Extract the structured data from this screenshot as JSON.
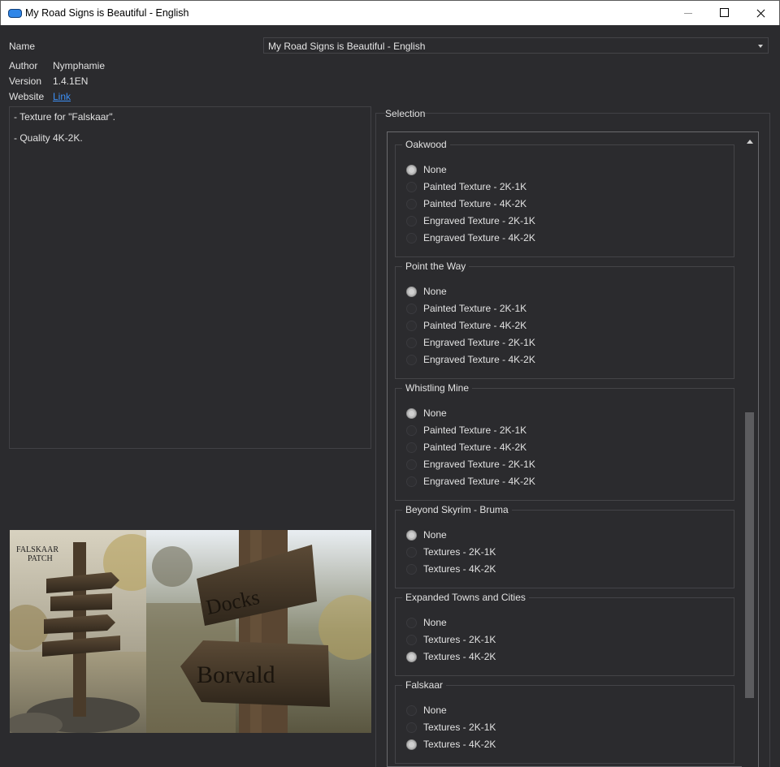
{
  "window": {
    "title": "My Road Signs is Beautiful - English"
  },
  "info": {
    "name_label": "Name",
    "name_value": "My Road Signs is Beautiful - English",
    "author_label": "Author",
    "author_value": "Nymphamie",
    "version_label": "Version",
    "version_value": "1.4.1EN",
    "website_label": "Website",
    "website_link": "Link"
  },
  "description": [
    "- Texture for \"Falskaar\".",
    "- Quality 4K-2K."
  ],
  "preview": {
    "sign_left_badge_line1": "FALSKAAR",
    "sign_left_badge_line2": "PATCH",
    "sign_right_top": "Docks",
    "sign_right_bottom": "Borvald"
  },
  "selection": {
    "title": "Selection",
    "groups": [
      {
        "title": "Oakwood",
        "options": [
          "None",
          "Painted Texture - 2K-1K",
          "Painted Texture - 4K-2K",
          "Engraved Texture - 2K-1K",
          "Engraved Texture - 4K-2K"
        ],
        "selected": 0
      },
      {
        "title": "Point the Way",
        "options": [
          "None",
          "Painted Texture - 2K-1K",
          "Painted Texture - 4K-2K",
          "Engraved Texture - 2K-1K",
          "Engraved Texture - 4K-2K"
        ],
        "selected": 0
      },
      {
        "title": "Whistling Mine",
        "options": [
          "None",
          "Painted Texture - 2K-1K",
          "Painted Texture - 4K-2K",
          "Engraved Texture - 2K-1K",
          "Engraved Texture - 4K-2K"
        ],
        "selected": 0
      },
      {
        "title": "Beyond Skyrim - Bruma",
        "options": [
          "None",
          "Textures - 2K-1K",
          "Textures - 4K-2K"
        ],
        "selected": 0
      },
      {
        "title": "Expanded Towns and Cities",
        "options": [
          "None",
          "Textures - 2K-1K",
          "Textures - 4K-2K"
        ],
        "selected": 2
      },
      {
        "title": "Falskaar",
        "options": [
          "None",
          "Textures - 2K-1K",
          "Textures - 4K-2K"
        ],
        "selected": 2
      }
    ]
  },
  "colors": {
    "background": "#2b2b2e",
    "link": "#3d8ff5",
    "selected_radio": "#b9b9b9"
  }
}
